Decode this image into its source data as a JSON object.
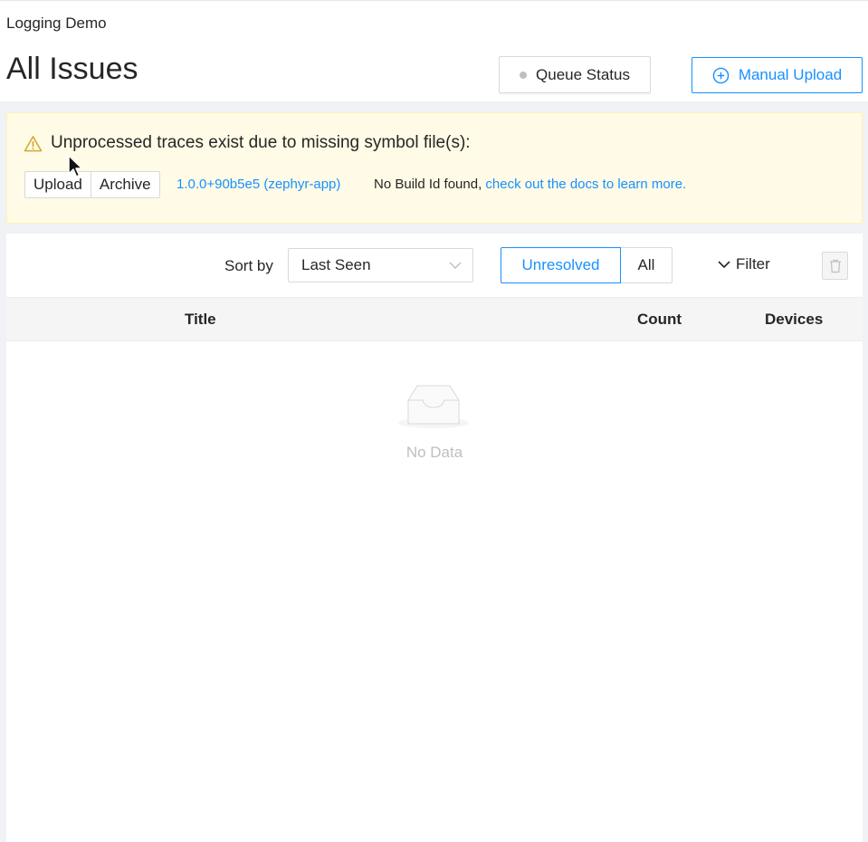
{
  "header": {
    "project_name": "Logging Demo",
    "title": "All Issues",
    "queue_status_label": "Queue Status",
    "manual_upload_label": "Manual Upload"
  },
  "alert": {
    "message": "Unprocessed traces exist due to missing symbol file(s):",
    "upload_label": "Upload",
    "archive_label": "Archive",
    "build_version": "1.0.0+90b5e5 (zephyr-app)",
    "no_build_text": "No Build Id found, ",
    "docs_link": "check out the docs to learn more."
  },
  "toolbar": {
    "sort_label": "Sort by",
    "sort_value": "Last Seen",
    "tab_unresolved": "Unresolved",
    "tab_all": "All",
    "filter_label": "Filter"
  },
  "table": {
    "columns": [
      "Title",
      "Count",
      "Devices"
    ],
    "empty_text": "No Data"
  },
  "colors": {
    "accent": "#1890ff",
    "warning_bg": "#fffbe6",
    "warning_icon": "#d4a72c"
  }
}
